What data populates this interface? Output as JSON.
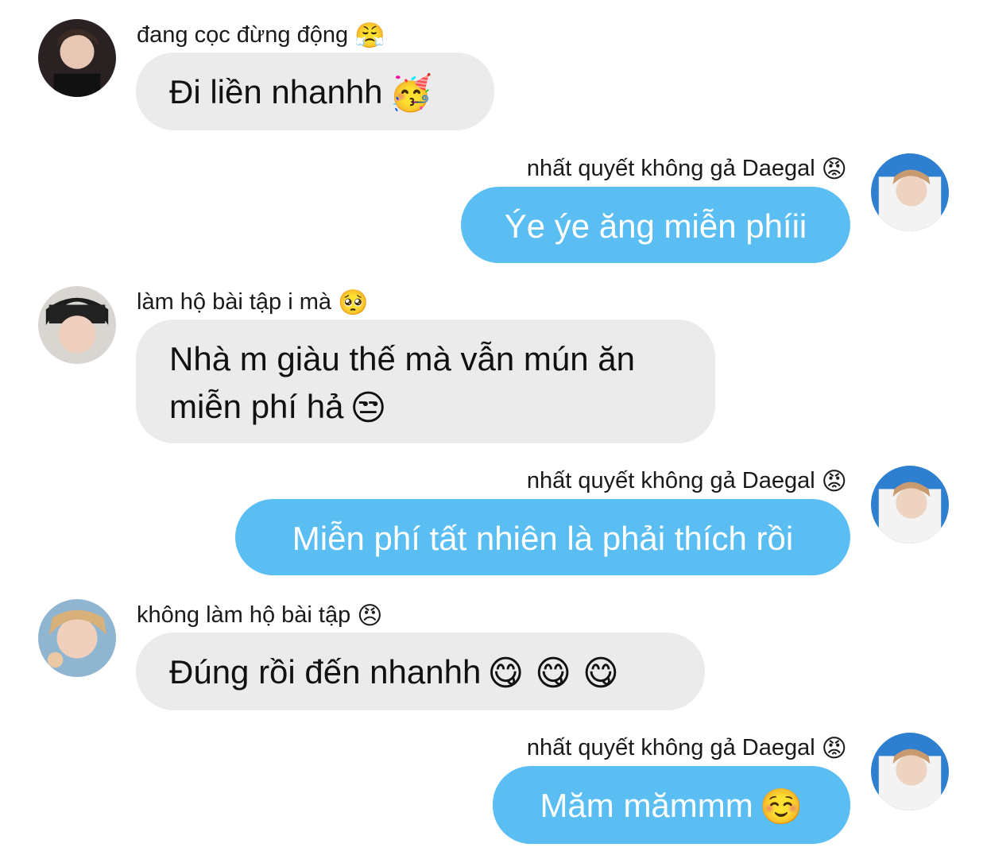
{
  "messages": [
    {
      "side": "in",
      "sender": "đang cọc đừng động",
      "sender_emoji": "😤",
      "text": "Đi liền nhanhh",
      "emoji": "🥳"
    },
    {
      "side": "out",
      "sender": "nhất quyết không gả Daegal",
      "sender_emoji": "😡",
      "text": "Ýe ýe ăng miễn phíii",
      "emoji": ""
    },
    {
      "side": "in",
      "sender": "làm hộ bài tập i mà",
      "sender_emoji": "🥺",
      "text_line1": "Nhà m giàu thế mà vẫn mún ăn",
      "text_line2": "miễn phí hả",
      "emoji": "😒"
    },
    {
      "side": "out",
      "sender": "nhất quyết không gả Daegal",
      "sender_emoji": "😡",
      "text": "Miễn phí tất nhiên là phải thích rồi",
      "emoji": ""
    },
    {
      "side": "in",
      "sender": "không làm hộ bài tập",
      "sender_emoji": "😠",
      "text": "Đúng rồi đến nhanhh",
      "emoji": "😋 😋 😋"
    },
    {
      "side": "out",
      "sender": "nhất quyết không gả Daegal",
      "sender_emoji": "😡",
      "text": "Măm măm mmm",
      "text_display": "Măm mămmm",
      "emoji": "☺️"
    }
  ]
}
